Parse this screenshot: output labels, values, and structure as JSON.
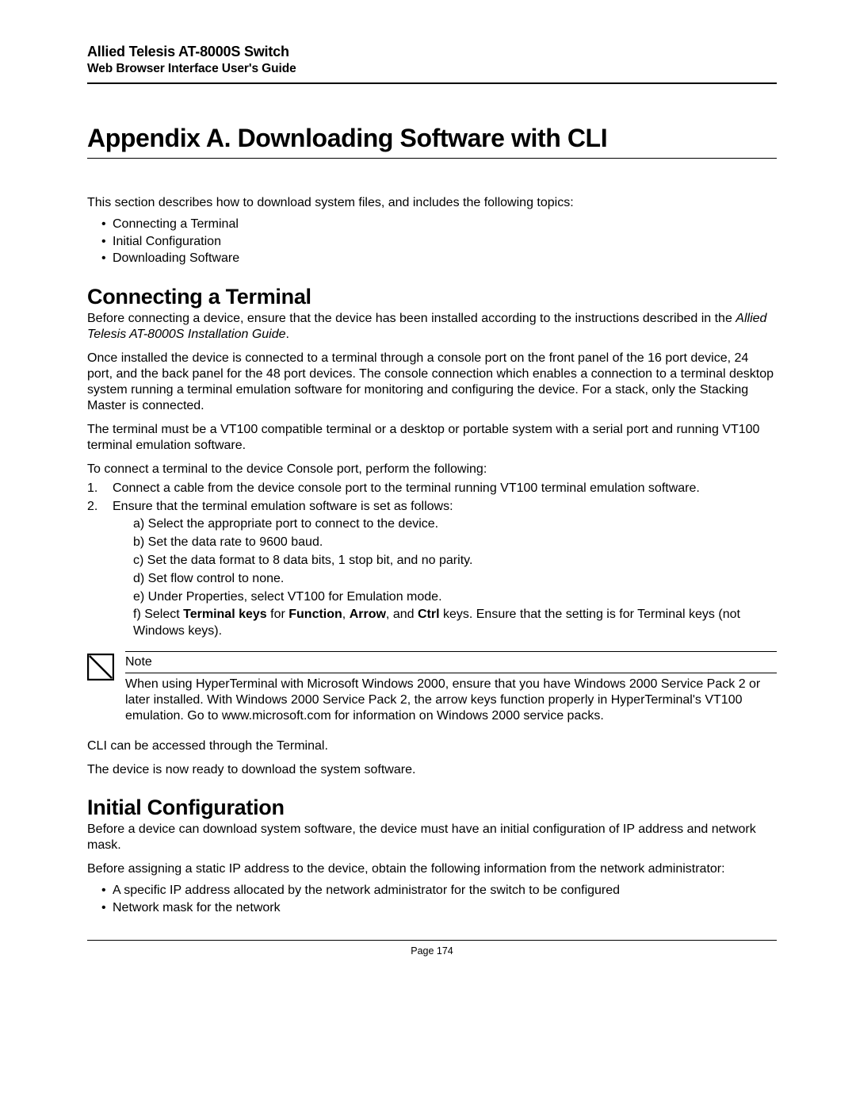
{
  "header": {
    "line1": "Allied Telesis AT-8000S Switch",
    "line2": "Web Browser Interface User's Guide"
  },
  "title": "Appendix A. Downloading Software with CLI",
  "intro": "This section describes how to download system files, and includes the following topics:",
  "topics": [
    "Connecting a Terminal",
    "Initial Configuration",
    "Downloading Software"
  ],
  "section1": {
    "title": "Connecting a Terminal",
    "p1a": "Before connecting a device, ensure that the device has been installed according to the instructions described in the ",
    "p1_ital": "Allied Telesis AT-8000S Installation Guide",
    "p1b": ".",
    "p2": "Once installed the device is connected to a terminal through a console port on the front panel of the 16 port device, 24 port, and the back panel for the 48 port devices. The console connection which enables a connection to a terminal desktop system running a terminal emulation software for monitoring and configuring the device. For a stack, only the Stacking Master is connected.",
    "p3": "The terminal must be a VT100 compatible terminal or a desktop or portable system with a serial port and running VT100 terminal emulation software.",
    "p4": "To connect a terminal to the device Console port, perform the following:",
    "step1": "Connect a cable from the device console port to the terminal running VT100 terminal emulation software.",
    "step2": "Ensure that the terminal emulation software is set as follows:",
    "sub_a": "a) Select the appropriate port to connect to the device.",
    "sub_b": "b) Set the data rate to 9600 baud.",
    "sub_c": "c) Set the data format to 8 data bits, 1 stop bit, and no parity.",
    "sub_d": "d) Set flow control to none.",
    "sub_e": "e) Under Properties, select VT100 for Emulation mode.",
    "sub_f_pre": "f) Select ",
    "sub_f_b1": "Terminal keys",
    "sub_f_mid1": " for ",
    "sub_f_b2": "Function",
    "sub_f_mid2": ", ",
    "sub_f_b3": "Arrow",
    "sub_f_mid3": ", and ",
    "sub_f_b4": "Ctrl",
    "sub_f_post": " keys. Ensure that the setting is for Terminal keys (not Windows keys).",
    "note_label": "Note",
    "note_body": "When using HyperTerminal with Microsoft Windows 2000, ensure that you have Windows 2000 Service Pack 2 or later installed. With Windows 2000 Service Pack 2, the arrow keys function properly in HyperTerminal's VT100 emulation. Go to www.microsoft.com for information on Windows 2000 service packs.",
    "p5": "CLI can be accessed through the Terminal.",
    "p6": "The device is now ready to download the system software."
  },
  "section2": {
    "title": "Initial Configuration",
    "p1": "Before a device can download system software, the device must have an initial configuration of IP address and network mask.",
    "p2": "Before assigning a static IP address to the device, obtain the following information from the network administrator:",
    "bullets": [
      "A specific IP address allocated by the network administrator for the switch to be configured",
      "Network mask for the network"
    ]
  },
  "footer": "Page 174"
}
